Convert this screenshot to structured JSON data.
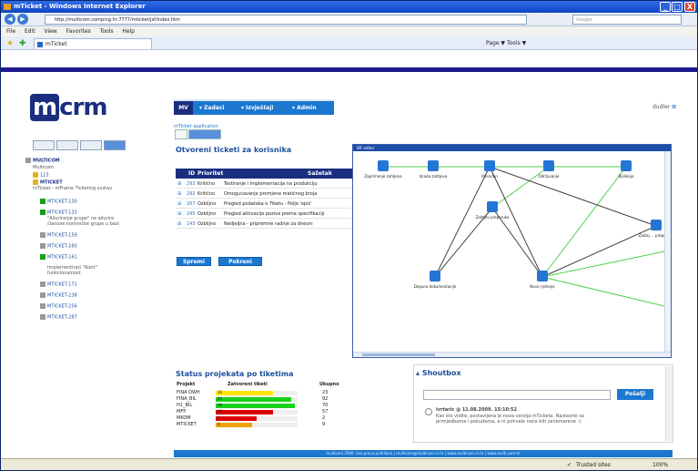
{
  "window": {
    "title": "mTicket - Windows Internet Explorer",
    "min": "_",
    "max": "□",
    "close": "X"
  },
  "address": {
    "url": "http://multicom.comping.hr:7777/mticket/jsf/index.htm",
    "search_placeholder": "Google",
    "back": "◀",
    "forward": "▶"
  },
  "menu": [
    "File",
    "Edit",
    "View",
    "Favorites",
    "Tools",
    "Help"
  ],
  "browser_tab": {
    "label": "mTicket"
  },
  "ie_tools": "Page ▼  Tools ▼",
  "logo": {
    "text": "crm",
    "prefix": "m"
  },
  "nav": {
    "mv": "MV",
    "items": [
      "Zadaci",
      "Izvještaji",
      "Admin"
    ]
  },
  "user": "dudler",
  "breadcrumb": "mTicket application",
  "tree": [
    {
      "label": "MULTICOM",
      "level": 0,
      "icon": "user"
    },
    {
      "label": "Multicom",
      "level": 1,
      "icon": ""
    },
    {
      "label": "123",
      "level": 1,
      "icon": "pkg"
    },
    {
      "label": "MTICKET",
      "level": 1,
      "icon": "pkg"
    },
    {
      "label": "mTicket - mFrame Ticketing sustav",
      "level": 1,
      "icon": ""
    },
    {
      "label": "MTICKET-130",
      "level": 2,
      "icon": "green"
    },
    {
      "label": "MTICKET-132",
      "level": 2,
      "icon": "green"
    },
    {
      "label": "\"Ažuriranje grupe\" ne ažurira",
      "level": 3,
      "icon": ""
    },
    {
      "label": "članove korisničke grupe u bazi",
      "level": 3,
      "icon": ""
    },
    {
      "label": "MTICKET-159",
      "level": 2,
      "icon": "gray"
    },
    {
      "label": "MTICKET-160",
      "level": 2,
      "icon": "gray"
    },
    {
      "label": "MTICKET-161",
      "level": 2,
      "icon": "green"
    },
    {
      "label": "Implementirati \"Alert\"",
      "level": 3,
      "icon": ""
    },
    {
      "label": "funkcionalnost",
      "level": 3,
      "icon": ""
    },
    {
      "label": "MTICKET-171",
      "level": 2,
      "icon": "gray"
    },
    {
      "label": "MTICKET-238",
      "level": 2,
      "icon": "gray"
    },
    {
      "label": "MTICKET-256",
      "level": 2,
      "icon": "gray"
    },
    {
      "label": "MTICKET-287",
      "level": 2,
      "icon": "gray"
    }
  ],
  "tickets": {
    "title": "Otvoreni ticketi za korisnika",
    "columns": [
      "ID",
      "Prioritet",
      "Sažetak"
    ],
    "rows": [
      {
        "id": "293",
        "priority": "Kritično",
        "summary": "Testiranje i implementacija na produkciju"
      },
      {
        "id": "292",
        "priority": "Kritično",
        "summary": "Omogućavanje promjene matičnog broja"
      },
      {
        "id": "207",
        "priority": "Ozbiljno",
        "summary": "Pregled podataka o Tiketu - Polje 'opis'"
      },
      {
        "id": "245",
        "priority": "Ozbiljno",
        "summary": "Pregled aktivacije poziva prema specifikaciji"
      },
      {
        "id": "143",
        "priority": "Ozbiljno",
        "summary": "Nedjeljna - pripremne radnje za dnevni"
      }
    ],
    "btn_save": "Spremi",
    "btn_run": "Pokreni"
  },
  "workflow": {
    "title": "WF editor",
    "nodes": [
      {
        "label": "Zaprimanje zahtjeva",
        "n": "nz"
      },
      {
        "label": "Izrada zahtjeva",
        "n": "iz"
      },
      {
        "label": "Proračun",
        "n": "pr"
      },
      {
        "label": "Održavanje",
        "n": "od"
      },
      {
        "label": "Rješenje",
        "n": "rj"
      },
      {
        "label": "Zahtjev preporuke",
        "n": "zp"
      },
      {
        "label": "Zaklaj ... preporuka",
        "n": "zk"
      },
      {
        "label": "Dopuna dokumentacije",
        "n": "dd"
      },
      {
        "label": "Novo rješenje",
        "n": "nr"
      }
    ]
  },
  "projects": {
    "title": "Status projekata po tiketima",
    "columns": [
      "Projekt",
      "Zatvoreni tiketi",
      "Ukupno"
    ],
    "rows": [
      {
        "name": "FINA DWH",
        "closed": 16,
        "total": 23,
        "color": "#ffe600"
      },
      {
        "name": "FINA_BIL",
        "closed": 85,
        "total": 92,
        "color": "#1bd01b"
      },
      {
        "name": "H1_BIL",
        "closed": 68,
        "total": 70,
        "color": "#1bd01b"
      },
      {
        "name": "MFP",
        "closed": 40,
        "total": 57,
        "color": "#dd0000"
      },
      {
        "name": "MKOM",
        "closed": 1,
        "total": 2,
        "color": "#dd0000"
      },
      {
        "name": "MTICKET",
        "closed": 4,
        "total": 9,
        "color": "#f0a000"
      }
    ]
  },
  "shoutbox": {
    "title": "Shoutbox",
    "send": "Pošalji",
    "author": "ivrtaric @ 11.08.2009. 15:10:52",
    "msg1": "Kao što vidite, postavljena je nova verzija mTicketa. Nastavite sa",
    "msg2": "primjedbama i pokudama, a ni pohvale neće biti zanemarene :)"
  },
  "footer": "multicom 2009. Sva prava pridržana | multicom@multicom-rs.hr | www.multicom-rs.hr | www.multi.com.hr",
  "statusbar": {
    "zone": "Trusted sites",
    "zoom": "100%"
  }
}
